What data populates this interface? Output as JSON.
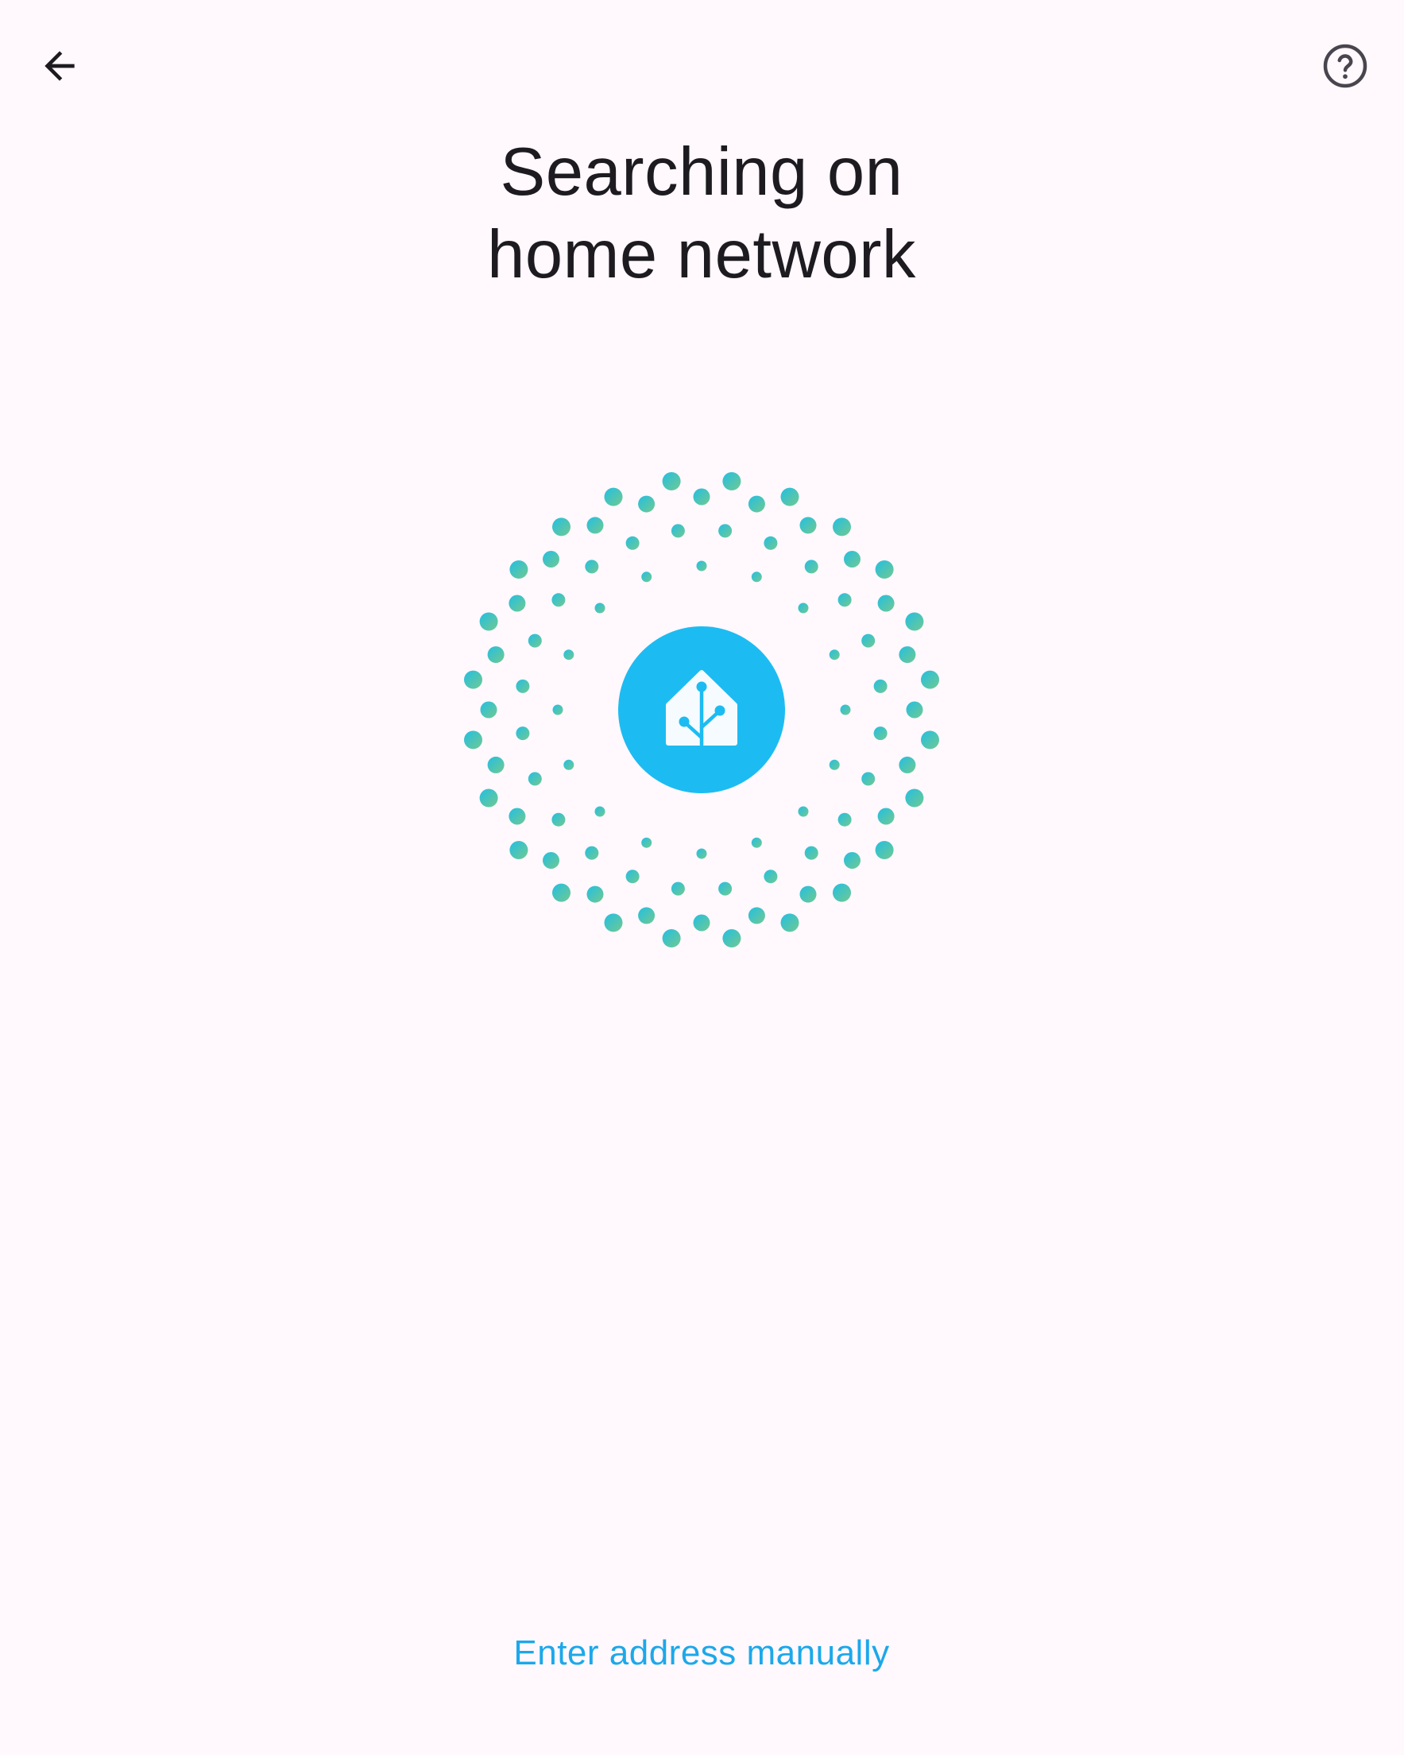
{
  "header": {
    "back_icon": "arrow-left-icon",
    "help_icon": "help-circle-icon"
  },
  "title": {
    "line1": "Searching on",
    "line2": "home network"
  },
  "animation": {
    "logo_icon": "home-assistant-logo-icon",
    "logo_color": "#1cbcf2",
    "dot_color_start": "#22bfe3",
    "dot_color_end": "#72c98f"
  },
  "actions": {
    "manual_entry_label": "Enter address manually"
  },
  "colors": {
    "background": "#fff8fd",
    "text": "#1d1b20",
    "accent": "#1ca8ea"
  }
}
